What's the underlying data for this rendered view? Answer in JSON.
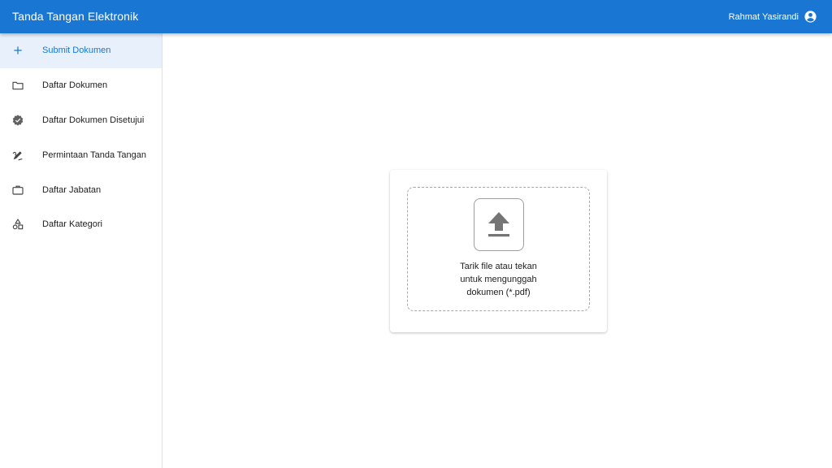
{
  "app": {
    "title": "Tanda Tangan Elektronik",
    "accent_color": "#1976d2"
  },
  "user": {
    "name": "Rahmat Yasirandi",
    "icon": "account-circle-icon"
  },
  "sidebar": {
    "items": [
      {
        "label": "Submit Dokumen",
        "icon": "plus-icon",
        "active": true
      },
      {
        "label": "Daftar Dokumen",
        "icon": "folder-icon",
        "active": false
      },
      {
        "label": "Daftar Dokumen Disetujui",
        "icon": "verified-badge-icon",
        "active": false
      },
      {
        "label": "Permintaan Tanda Tangan",
        "icon": "signature-pen-icon",
        "active": false
      },
      {
        "label": "Daftar Jabatan",
        "icon": "briefcase-icon",
        "active": false
      },
      {
        "label": "Daftar Kategori",
        "icon": "shapes-icon",
        "active": false
      }
    ]
  },
  "upload": {
    "icon": "upload-icon",
    "text_lines": [
      "Tarik file atau tekan",
      "untuk mengunggah",
      "dokumen (*.pdf)"
    ]
  }
}
